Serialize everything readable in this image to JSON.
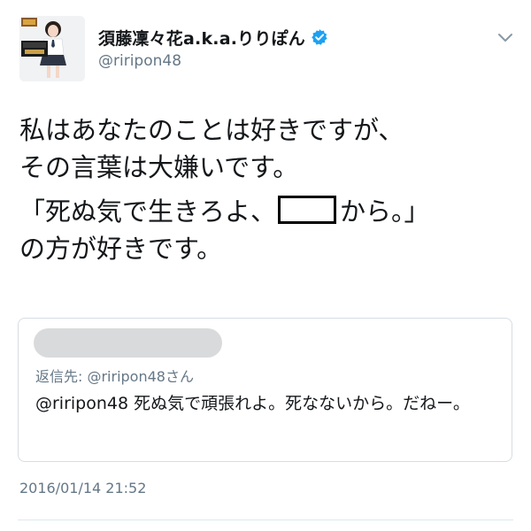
{
  "author": {
    "display_name": "須藤凜々花a.k.a.りりぽん",
    "username": "@riripon48",
    "verified": true,
    "avatar_icon": "profile-photo-icon",
    "verified_icon": "verified-badge-icon"
  },
  "tweet": {
    "lines": [
      "私はあなたのことは好きですが、",
      "その言葉は大嫌いです。",
      "「死ぬ気で生きろよ、",
      "から。」",
      "の方が好きです。"
    ]
  },
  "quoted_reply": {
    "replying_to": "返信先: @riripon48さん",
    "text": "@riripon48 死ぬ気で頑張れよ。死なないから。だねー。"
  },
  "timestamp": "2016/01/14 21:52",
  "menu_icon": "chevron-down-icon",
  "colors": {
    "text_primary": "#14171a",
    "text_secondary": "#657786",
    "verified_blue": "#1da1f2",
    "border": "#d6dde3"
  }
}
